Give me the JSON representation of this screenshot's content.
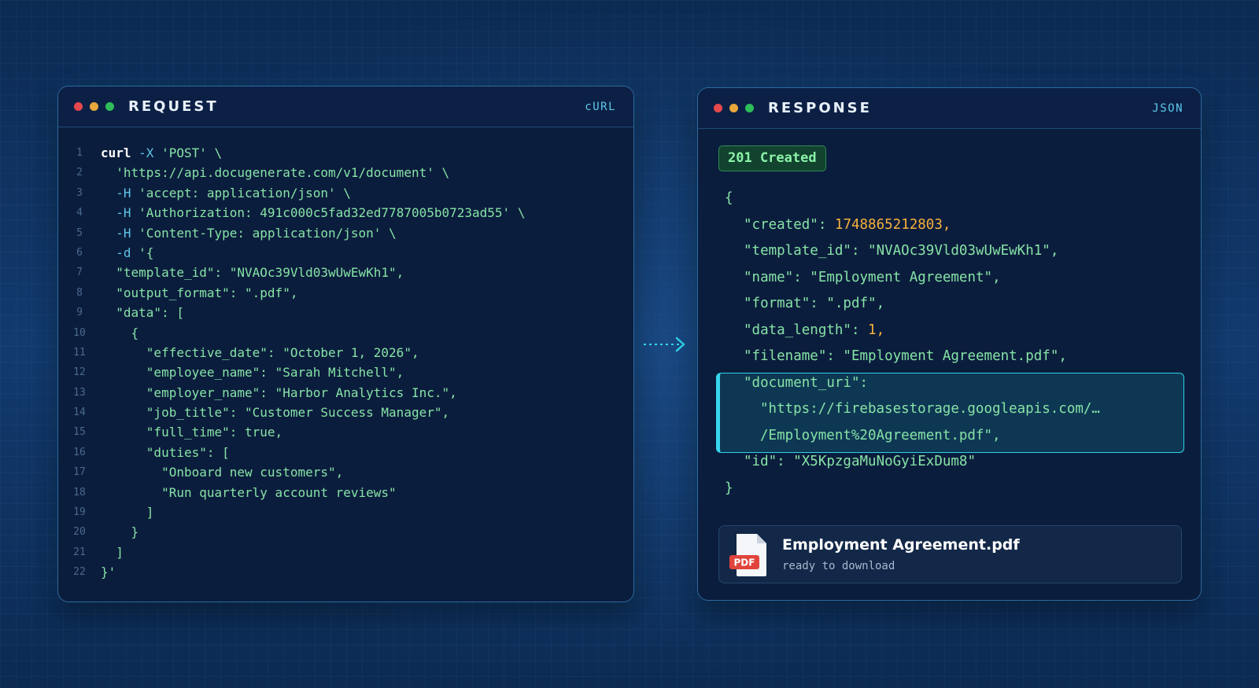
{
  "colors": {
    "dot_red": "#e5484d",
    "dot_yellow": "#e8a93a",
    "dot_green": "#2ebd59",
    "accent": "#36d6ee"
  },
  "request": {
    "title": "REQUEST",
    "tag": "cURL",
    "lines": [
      {
        "n": "1",
        "parts": [
          {
            "t": "curl",
            "c": "kw"
          },
          {
            "t": " -X ",
            "c": "flag"
          },
          {
            "t": "'POST' \\",
            "c": "str"
          }
        ]
      },
      {
        "n": "2",
        "parts": [
          {
            "t": "  'https://api.docugenerate.com/v1/document' \\",
            "c": "str"
          }
        ]
      },
      {
        "n": "3",
        "parts": [
          {
            "t": "  -H ",
            "c": "flag"
          },
          {
            "t": "'accept: application/json' \\",
            "c": "str"
          }
        ]
      },
      {
        "n": "4",
        "parts": [
          {
            "t": "  -H ",
            "c": "flag"
          },
          {
            "t": "'Authorization: 491c000c5fad32ed7787005b0723ad55' \\",
            "c": "str"
          }
        ]
      },
      {
        "n": "5",
        "parts": [
          {
            "t": "  -H ",
            "c": "flag"
          },
          {
            "t": "'Content-Type: application/json' \\",
            "c": "str"
          }
        ]
      },
      {
        "n": "6",
        "parts": [
          {
            "t": "  -d ",
            "c": "flag"
          },
          {
            "t": "'{",
            "c": "str"
          }
        ]
      },
      {
        "n": "7",
        "parts": [
          {
            "t": "  \"template_id\": \"NVAOc39Vld03wUwEwKh1\",",
            "c": "str"
          }
        ]
      },
      {
        "n": "8",
        "parts": [
          {
            "t": "  \"output_format\": \".pdf\",",
            "c": "str"
          }
        ]
      },
      {
        "n": "9",
        "parts": [
          {
            "t": "  \"data\": [",
            "c": "str"
          }
        ]
      },
      {
        "n": "10",
        "parts": [
          {
            "t": "    {",
            "c": "str"
          }
        ]
      },
      {
        "n": "11",
        "parts": [
          {
            "t": "      \"effective_date\": \"October 1, 2026\",",
            "c": "str"
          }
        ]
      },
      {
        "n": "12",
        "parts": [
          {
            "t": "      \"employee_name\": \"Sarah Mitchell\",",
            "c": "str"
          }
        ]
      },
      {
        "n": "13",
        "parts": [
          {
            "t": "      \"employer_name\": \"Harbor Analytics Inc.\",",
            "c": "str"
          }
        ]
      },
      {
        "n": "14",
        "parts": [
          {
            "t": "      \"job_title\": \"Customer Success Manager\",",
            "c": "str"
          }
        ]
      },
      {
        "n": "15",
        "parts": [
          {
            "t": "      \"full_time\": true,",
            "c": "str"
          }
        ]
      },
      {
        "n": "16",
        "parts": [
          {
            "t": "      \"duties\": [",
            "c": "str"
          }
        ]
      },
      {
        "n": "17",
        "parts": [
          {
            "t": "        \"Onboard new customers\",",
            "c": "str"
          }
        ]
      },
      {
        "n": "18",
        "parts": [
          {
            "t": "        \"Run quarterly account reviews\"",
            "c": "str"
          }
        ]
      },
      {
        "n": "19",
        "parts": [
          {
            "t": "      ]",
            "c": "str"
          }
        ]
      },
      {
        "n": "20",
        "parts": [
          {
            "t": "    }",
            "c": "str"
          }
        ]
      },
      {
        "n": "21",
        "parts": [
          {
            "t": "  ]",
            "c": "str"
          }
        ]
      },
      {
        "n": "22",
        "parts": [
          {
            "t": "}'",
            "c": "str"
          }
        ]
      }
    ]
  },
  "response": {
    "title": "RESPONSE",
    "tag": "JSON",
    "status": "201 Created",
    "lines": [
      {
        "i": 0,
        "parts": [
          {
            "t": "{",
            "c": "str"
          }
        ]
      },
      {
        "i": 1,
        "parts": [
          {
            "t": "\"created\": ",
            "c": "str"
          },
          {
            "t": "1748865212803,",
            "c": "num"
          }
        ]
      },
      {
        "i": 1,
        "parts": [
          {
            "t": "\"template_id\": \"NVAOc39Vld03wUwEwKh1\",",
            "c": "str"
          }
        ]
      },
      {
        "i": 1,
        "parts": [
          {
            "t": "\"name\": \"Employment Agreement\",",
            "c": "str"
          }
        ]
      },
      {
        "i": 1,
        "parts": [
          {
            "t": "\"format\": \".pdf\",",
            "c": "str"
          }
        ]
      },
      {
        "i": 1,
        "parts": [
          {
            "t": "\"data_length\": ",
            "c": "str"
          },
          {
            "t": "1,",
            "c": "num"
          }
        ]
      },
      {
        "i": 1,
        "parts": [
          {
            "t": "\"filename\": \"Employment Agreement.pdf\",",
            "c": "str"
          }
        ]
      },
      {
        "i": 1,
        "parts": [
          {
            "t": "\"document_uri\":",
            "c": "str"
          }
        ]
      },
      {
        "i": 2,
        "parts": [
          {
            "t": "\"https://firebasestorage.googleapis.com/…",
            "c": "str"
          }
        ]
      },
      {
        "i": 2,
        "parts": [
          {
            "t": "/Employment%20Agreement.pdf\",",
            "c": "str"
          }
        ]
      },
      {
        "i": 1,
        "parts": [
          {
            "t": "\"id\": \"X5KpzgaMuNoGyiExDum8\"",
            "c": "str"
          }
        ]
      },
      {
        "i": 0,
        "parts": [
          {
            "t": "}",
            "c": "str"
          }
        ]
      }
    ],
    "file": {
      "icon_label": "PDF",
      "name": "Employment Agreement.pdf",
      "status": "ready to download"
    }
  }
}
